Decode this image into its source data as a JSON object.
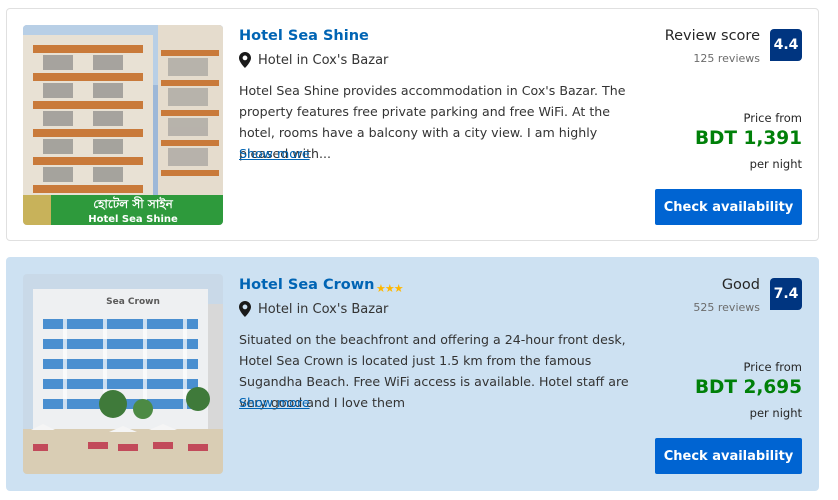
{
  "hotels": [
    {
      "name": "Hotel Sea Shine",
      "stars": "",
      "type": "Hotel in Cox's Bazar",
      "description": "Hotel Sea Shine provides accommodation in Cox's Bazar. The property features free private parking and free WiFi. At the hotel, rooms have a balcony with a city view. I am highly pleased with...",
      "show_more": "Show more",
      "score_label": "Review score",
      "reviews": "125 reviews",
      "score": "4.4",
      "price_from": "Price from",
      "price": "BDT 1,391",
      "per_night": "per night",
      "button": "Check availability",
      "sign_text": "হোটেল সী সাইন",
      "sign_text_en": "Hotel Sea Shine"
    },
    {
      "name": "Hotel Sea Crown",
      "stars": "★★★",
      "type": "Hotel in Cox's Bazar",
      "description": "Situated on the beachfront and offering a 24-hour front desk, Hotel Sea Crown is located just 1.5 km from the famous Sugandha Beach. Free WiFi access is available. Hotel staff are very good and I love them",
      "show_more": "Show more",
      "score_label": "Good",
      "reviews": "525 reviews",
      "score": "7.4",
      "price_from": "Price from",
      "price": "BDT 2,695",
      "per_night": "per night",
      "button": "Check availability",
      "sign_text": "Sea Crown"
    }
  ],
  "colors": {
    "link": "#0064b4",
    "badge": "#003580",
    "price": "#008009",
    "button": "#0064d2",
    "highlight_bg": "#cde1f2"
  },
  "icons": [
    "location-pin-icon",
    "star-icon"
  ]
}
